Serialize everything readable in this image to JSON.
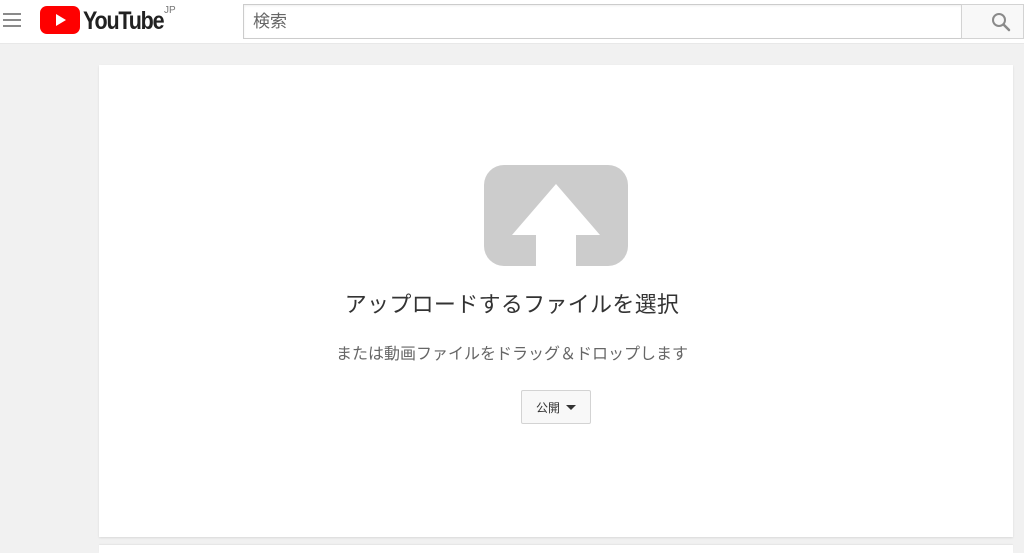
{
  "masthead": {
    "logo_text": "YouTube",
    "region": "JP",
    "search_placeholder": "検索",
    "icons": {
      "menu": "hamburger-icon",
      "logo": "youtube-play-icon",
      "search": "magnifier-icon"
    }
  },
  "upload": {
    "title": "アップロードするファイルを選択",
    "subtitle": "または動画ファイルをドラッグ＆ドロップします",
    "privacy_label": "公開",
    "icon": "upload-arrow-icon"
  },
  "colors": {
    "brand_red": "#ff0000",
    "background": "#f1f1f1",
    "upload_icon_gray": "#cccccc"
  }
}
